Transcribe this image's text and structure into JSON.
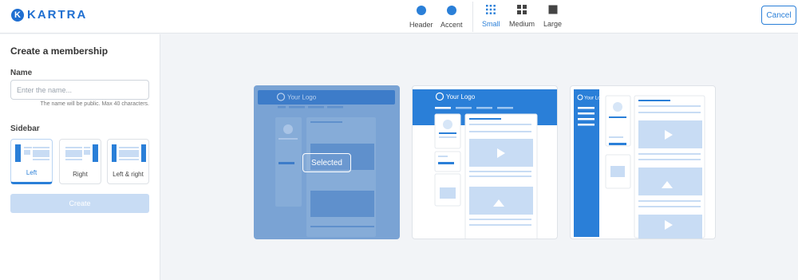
{
  "app": {
    "logo_text": "KARTRA",
    "logo_mark": "K"
  },
  "toolbar": {
    "color_options": [
      {
        "label": "Header",
        "color": "#2a7fd8"
      },
      {
        "label": "Accent",
        "color": "#2a7fd8"
      }
    ],
    "size_options": [
      {
        "label": "Small",
        "icon": "small-grid-icon",
        "selected": true
      },
      {
        "label": "Medium",
        "icon": "medium-grid-icon",
        "selected": false
      },
      {
        "label": "Large",
        "icon": "large-square-icon",
        "selected": false
      }
    ],
    "cancel_label": "Cancel"
  },
  "panel": {
    "title": "Create a membership",
    "name_label": "Name",
    "name_value": "",
    "name_placeholder": "Enter the name...",
    "name_hint": "The name will be public. Max 40 characters.",
    "sidebar_label": "Sidebar",
    "sidebar_options": [
      {
        "label": "Left",
        "selected": true
      },
      {
        "label": "Right",
        "selected": false
      },
      {
        "label": "Left & right",
        "selected": false
      }
    ],
    "create_label": "Create"
  },
  "templates": {
    "logo_text": "Your Logo",
    "selected_label": "Selected",
    "selected_index": 0
  },
  "colors": {
    "accent": "#2a7fd8",
    "accent_light": "#c8dcf4",
    "selected_overlay": "#7aa3d4"
  }
}
